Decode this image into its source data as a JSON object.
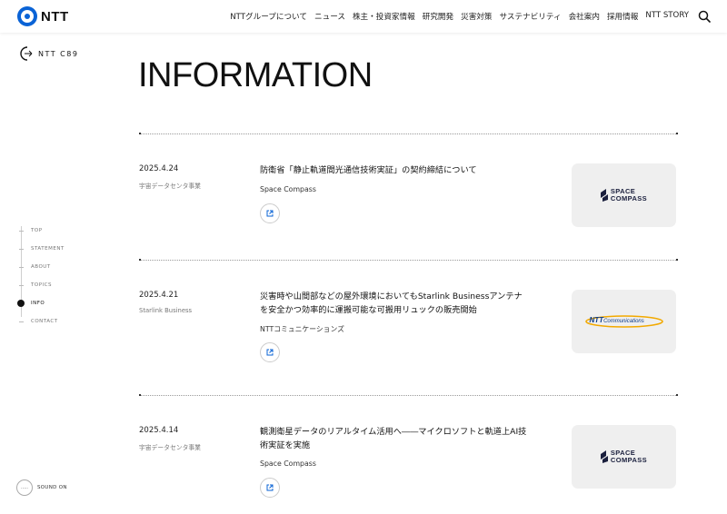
{
  "header": {
    "logo_text": "NTT",
    "nav": [
      "NTTグループについて",
      "ニュース",
      "株主・投資家情報",
      "研究開発",
      "災害対策",
      "サステナビリティ",
      "会社案内",
      "採用情報",
      "NTT STORY"
    ],
    "search_icon": "search-icon"
  },
  "brand": {
    "text": "NTT C89"
  },
  "sidenav": {
    "items": [
      "TOP",
      "STATEMENT",
      "ABOUT",
      "TOPICS",
      "INFO",
      "CONTACT"
    ],
    "active": "INFO"
  },
  "sound": {
    "label": "SOUND ON",
    "icon_text": "....."
  },
  "page_title": "INFORMATION",
  "entries": [
    {
      "date": "2025.4.24",
      "category": "宇宙データセンタ事業",
      "title": "防衛省「静止軌道間光通信技術実証」の契約締結について",
      "source": "Space Compass",
      "thumb": {
        "line1": "SPACE",
        "line2": "COMPASS"
      }
    },
    {
      "date": "2025.4.21",
      "category": "Starlink Business",
      "title": "災害時や山間部などの屋外環境においてもStarlink Businessアンテナを安全かつ効率的に運搬可能な可搬用リュックの販売開始",
      "source": "NTTコミュニケーションズ",
      "thumb": {
        "brand": "NTT",
        "suffix": "Communications"
      }
    },
    {
      "date": "2025.4.14",
      "category": "宇宙データセンタ事業",
      "title": "観測衛星データのリアルタイム活用へ――マイクロソフトと軌道上AI技術実証を実施",
      "source": "Space Compass",
      "thumb": {
        "line1": "SPACE",
        "line2": "COMPASS"
      }
    }
  ],
  "colors": {
    "accent": "#0a63d6",
    "thumb_bg": "#efefef",
    "dark_navy": "#1a1f3d",
    "link_blue": "#0a63d6",
    "ntt_orange": "#f2a900"
  }
}
